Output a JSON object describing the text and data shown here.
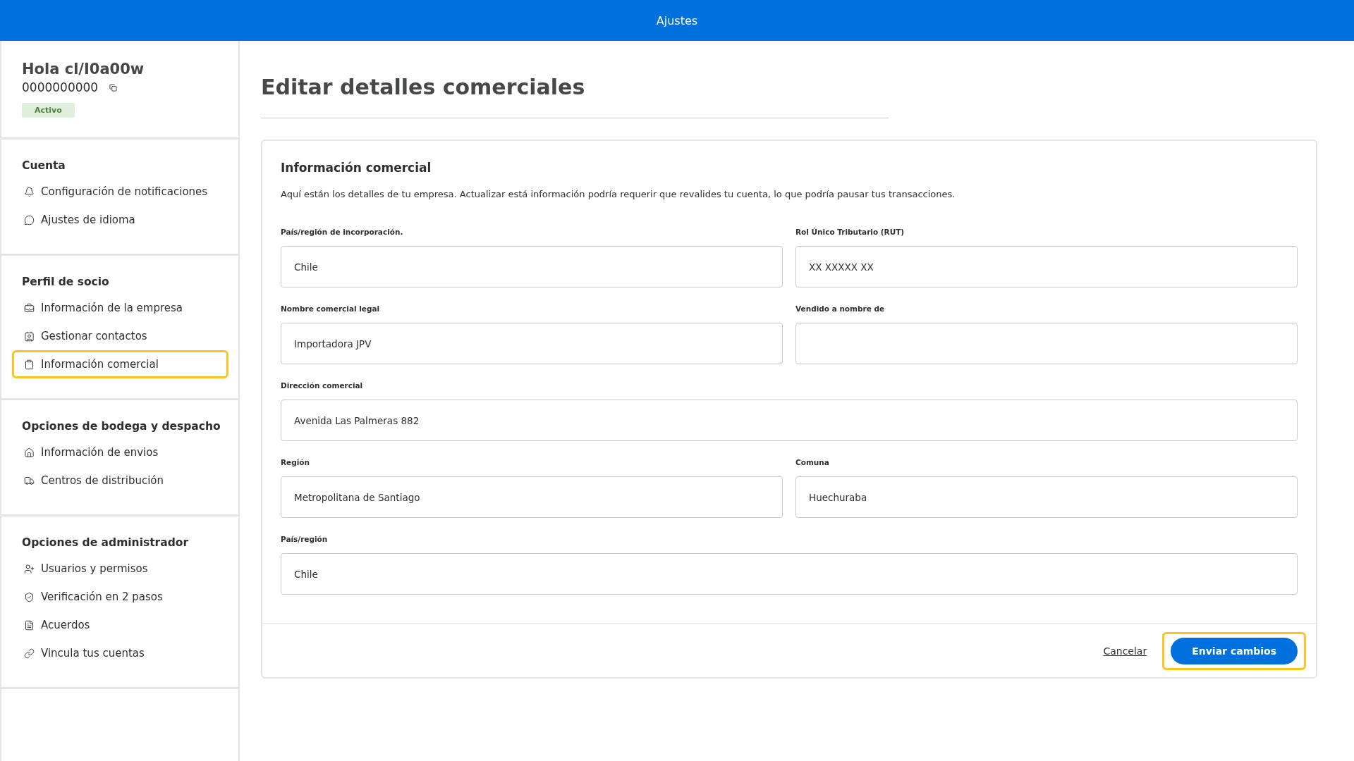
{
  "header": {
    "title": "Ajustes"
  },
  "profile": {
    "greeting": "Hola cl/I0a00w",
    "id": "0000000000",
    "status": "Activo"
  },
  "sidebar": {
    "sections": [
      {
        "title": "Cuenta",
        "items": [
          {
            "label": "Configuración de notificaciones",
            "highlighted": false
          },
          {
            "label": "Ajustes de idioma",
            "highlighted": false
          }
        ]
      },
      {
        "title": "Perfil de socio",
        "items": [
          {
            "label": "Información de la empresa",
            "highlighted": false
          },
          {
            "label": "Gestionar contactos",
            "highlighted": false
          },
          {
            "label": "Información comercial",
            "highlighted": true
          }
        ]
      },
      {
        "title": "Opciones de bodega y despacho",
        "items": [
          {
            "label": "Información de envios",
            "highlighted": false
          },
          {
            "label": "Centros de distribución",
            "highlighted": false
          }
        ]
      },
      {
        "title": "Opciones de administrador",
        "items": [
          {
            "label": "Usuarios y permisos",
            "highlighted": false
          },
          {
            "label": "Verificación en 2 pasos",
            "highlighted": false
          },
          {
            "label": "Acuerdos",
            "highlighted": false
          },
          {
            "label": "Vincula tus cuentas",
            "highlighted": false
          }
        ]
      }
    ]
  },
  "page": {
    "title": "Editar detalles comerciales"
  },
  "card": {
    "title": "Información comercial",
    "description": "Aquí están los detalles de tu empresa. Actualizar está información podría requerir que revalides tu cuenta, lo que podría pausar tus transacciones.",
    "fields": [
      {
        "label": "País/región de incorporación.",
        "value": "Chile",
        "kind": "half"
      },
      {
        "label": "Rol Único Tributario (RUT)",
        "value": "XX XXXXX XX",
        "kind": "half"
      },
      {
        "label": "Nombre comercial legal",
        "value": "Importadora JPV",
        "kind": "half"
      },
      {
        "label": "Vendido a nombre de",
        "kind": "half"
      },
      {
        "label": "Dirección comercial",
        "value": "Avenida Las Palmeras 882",
        "kind": "full"
      },
      {
        "label": "Región",
        "value": "Metropolitana de Santiago",
        "kind": "half"
      },
      {
        "label": "Comuna",
        "value": "Huechuraba",
        "kind": "half"
      },
      {
        "label": "País/región",
        "value": "Chile",
        "kind": "full"
      }
    ],
    "cancel": "Cancelar",
    "submit": {
      "label": "Enviar cambios",
      "highlighted": true
    }
  }
}
